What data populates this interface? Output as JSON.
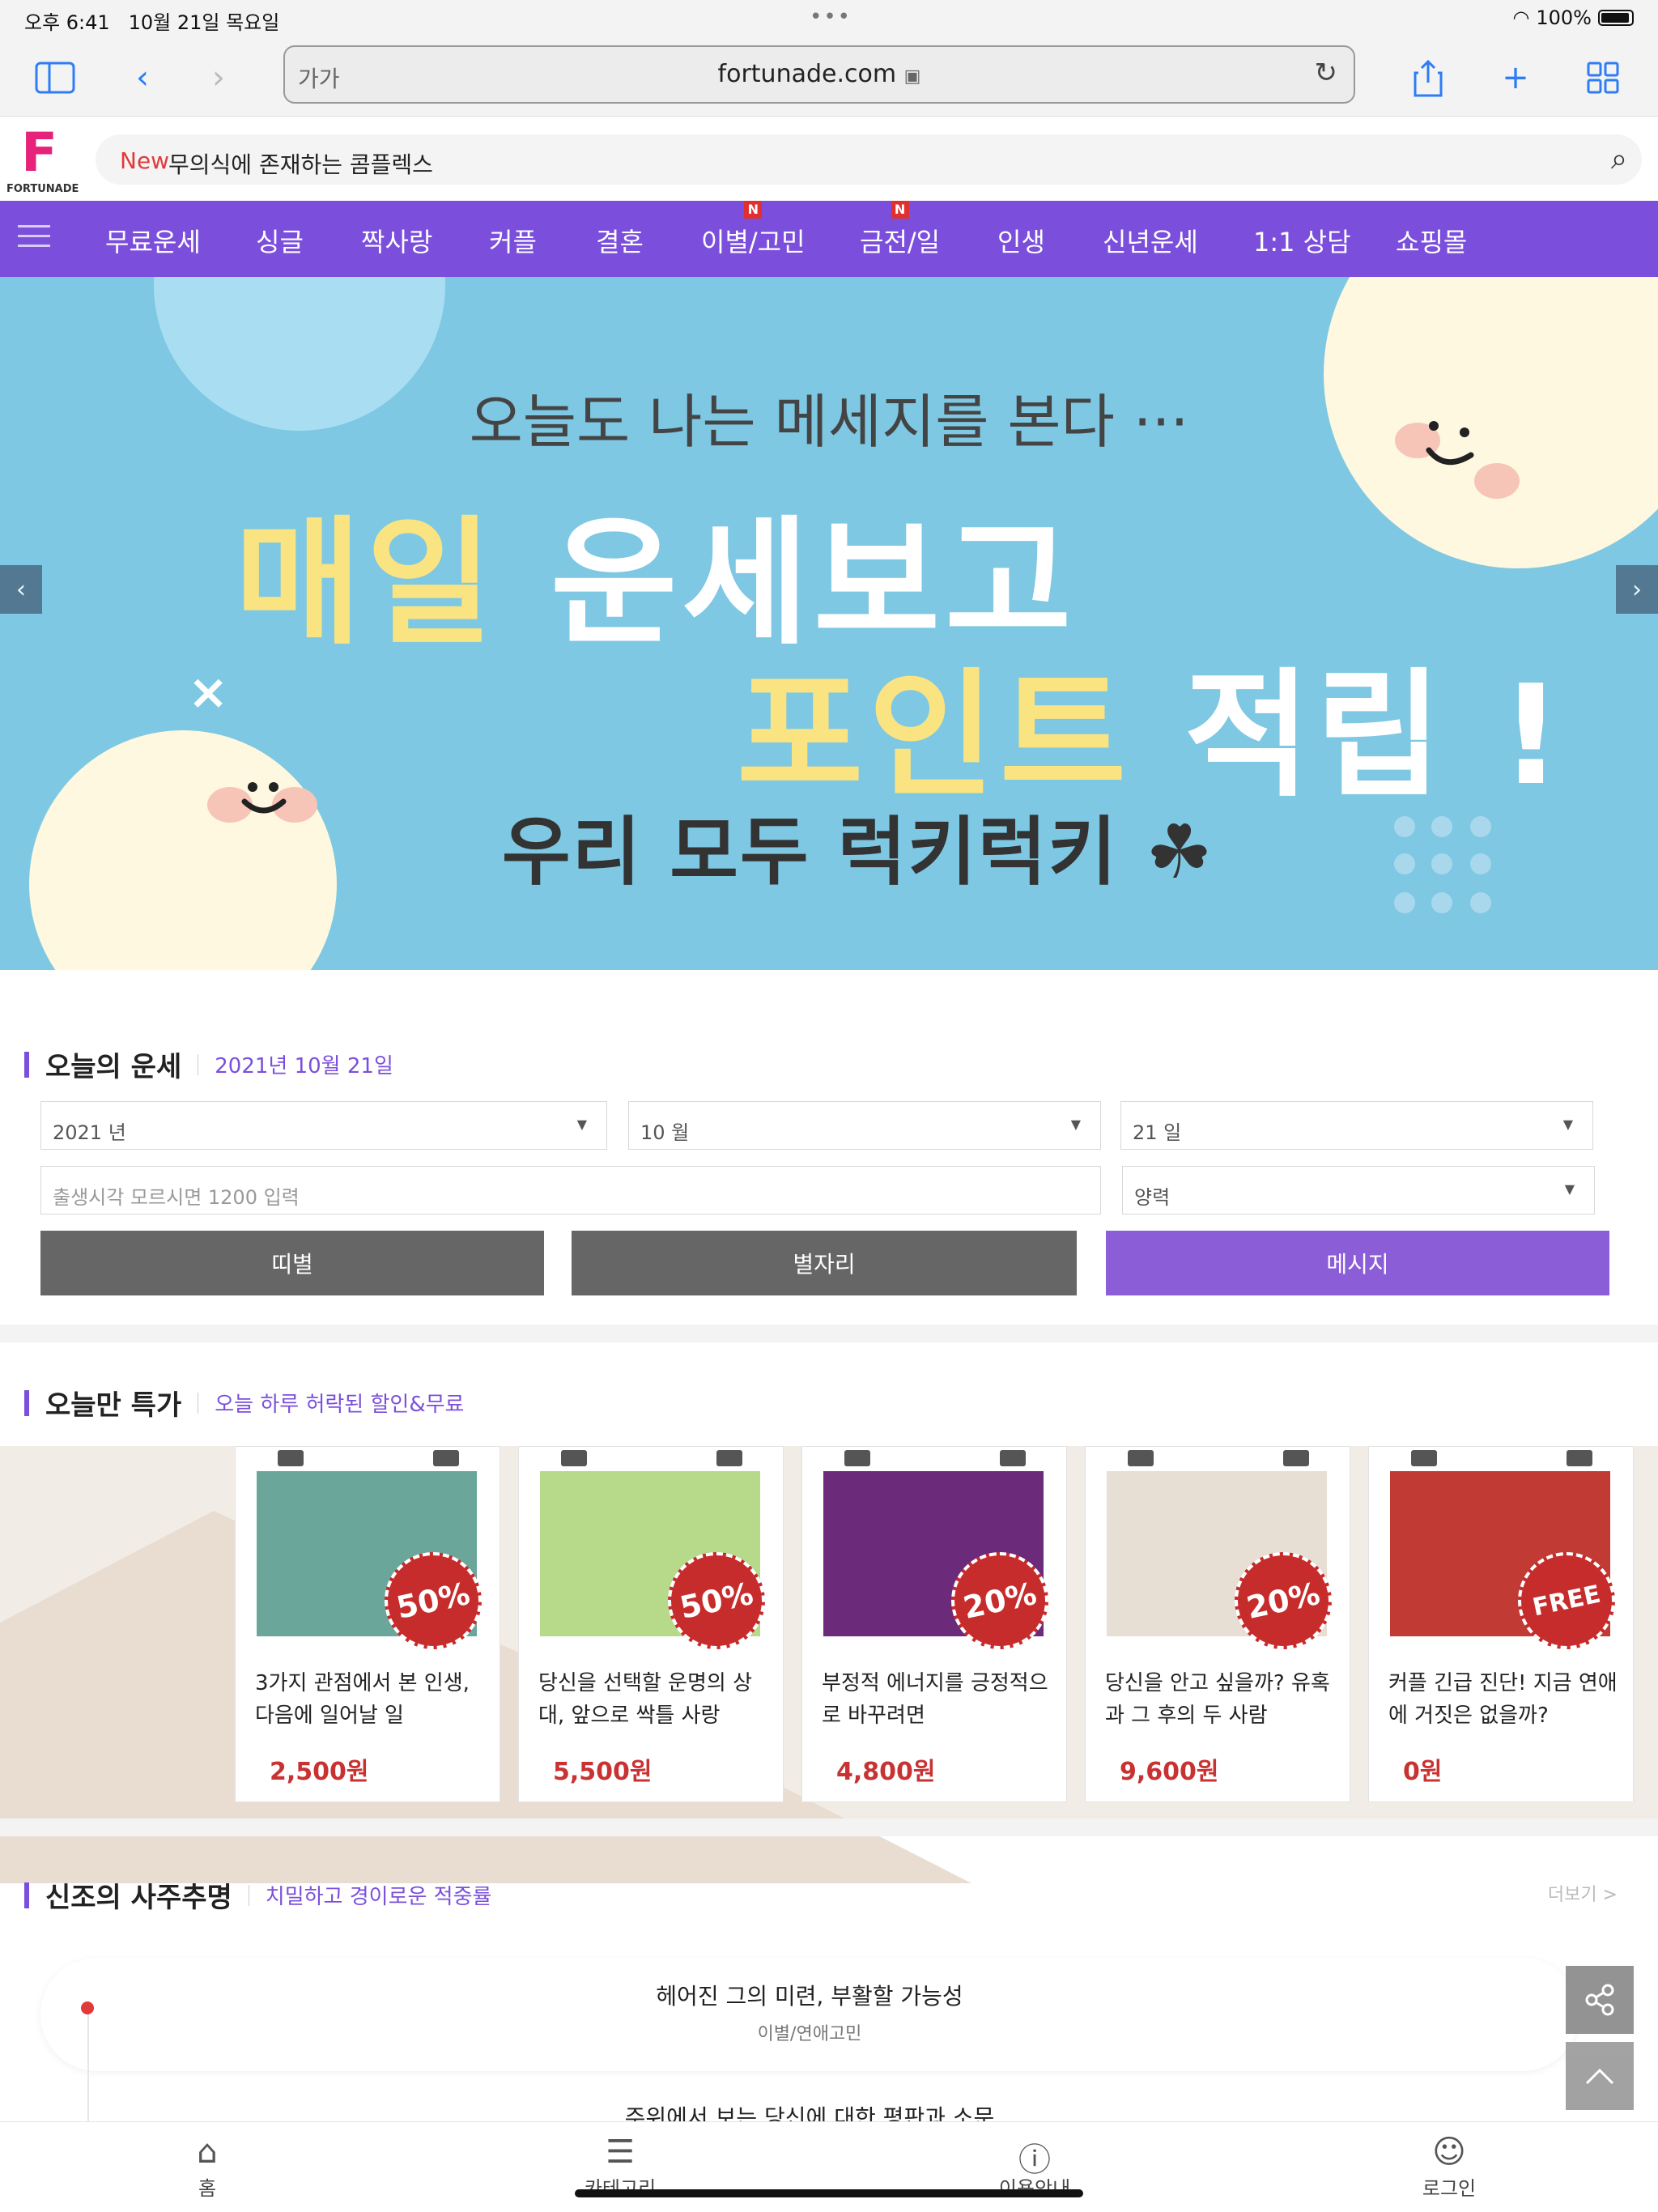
{
  "status": {
    "time": "오후 6:41",
    "date": "10월 21일 목요일",
    "battery": "100%"
  },
  "browser": {
    "aa": "가가",
    "host": "fortunade.com"
  },
  "site": {
    "logo_text": "FORTUNADE",
    "search_new": "New",
    "search_text": "무의식에 존재하는 콤플렉스"
  },
  "nav": [
    {
      "label": "무료운세",
      "badge": ""
    },
    {
      "label": "싱글",
      "badge": ""
    },
    {
      "label": "짝사랑",
      "badge": ""
    },
    {
      "label": "커플",
      "badge": ""
    },
    {
      "label": "결혼",
      "badge": ""
    },
    {
      "label": "이별/고민",
      "badge": "N"
    },
    {
      "label": "금전/일",
      "badge": "N"
    },
    {
      "label": "인생",
      "badge": ""
    },
    {
      "label": "신년운세",
      "badge": ""
    },
    {
      "label": "1:1 상담",
      "badge": ""
    },
    {
      "label": "쇼핑몰",
      "badge": ""
    }
  ],
  "banner": {
    "line1": "오늘도 나는 메세지를 본다 ···",
    "line2_hl": "매일",
    "line2": "운세보고",
    "line3_hl": "포인트",
    "line3": "적립 !",
    "line4": "우리 모두 럭키럭키 ☘",
    "x_mark": "×"
  },
  "today": {
    "title": "오늘의 운세",
    "date": "2021년 10월 21일",
    "year": "2021 년",
    "month": "10 월",
    "day": "21 일",
    "time_placeholder": "출생시각 모르시면 1200 입력",
    "calendar": "양력",
    "btn_zodiac": "띠별",
    "btn_star": "별자리",
    "btn_message": "메시지"
  },
  "specials": {
    "title": "오늘만 특가",
    "subtitle": "오늘 하루 허락된 할인&무료",
    "cards": [
      {
        "title": "3가지 관점에서 본 인생, 다음에 일어날 일",
        "price": "2,500원",
        "sale": "50%",
        "img_color": "#6aa79a"
      },
      {
        "title": "당신을 선택할 운명의 상대, 앞으로 싹틀 사랑",
        "price": "5,500원",
        "sale": "50%",
        "img_color": "#b6d98a"
      },
      {
        "title": "부정적 에너지를 긍정적으로 바꾸려면",
        "price": "4,800원",
        "sale": "20%",
        "img_color": "#6b2a7a"
      },
      {
        "title": "당신을 안고 싶을까? 유혹과 그 후의 두 사람",
        "price": "9,600원",
        "sale": "20%",
        "img_color": "#e7ded4"
      },
      {
        "title": "커플 긴급 진단! 지금 연애에 거짓은 없을까?",
        "price": "0원",
        "sale": "FREE",
        "img_color": "#c13a34"
      }
    ]
  },
  "saju": {
    "title": "신조의 사주추명",
    "subtitle": "치밀하고 경이로운 적중률",
    "more": "더보기 >",
    "items": [
      {
        "title": "헤어진 그의 미련, 부활할 가능성",
        "category": "이별/연애고민"
      },
      {
        "title": "주위에서 보는 당신에 대한 평판과 소문",
        "category": ""
      }
    ]
  },
  "tabbar": [
    {
      "label": "홈",
      "icon": "home-icon"
    },
    {
      "label": "카테고리",
      "icon": "list-icon"
    },
    {
      "label": "이용안내",
      "icon": "question-icon"
    },
    {
      "label": "로그인",
      "icon": "user-icon"
    }
  ]
}
